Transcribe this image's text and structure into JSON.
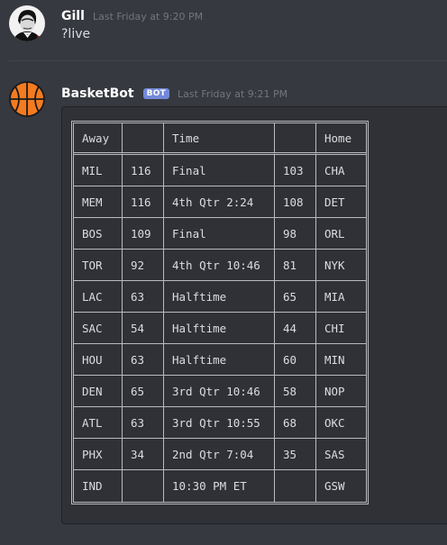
{
  "messages": [
    {
      "author": "Gill",
      "timestamp": "Last Friday at 9:20 PM",
      "text": "?live"
    },
    {
      "author": "BasketBot",
      "bot_tag": "BOT",
      "timestamp": "Last Friday at 9:21 PM"
    }
  ],
  "colors": {
    "background": "#36393f",
    "codeblock": "#2f3136",
    "bot_tag": "#7289da",
    "ball": "#f47b20"
  },
  "table": {
    "headers": [
      "Away",
      "",
      "Time",
      "",
      "Home"
    ],
    "rows": [
      [
        "MIL",
        "116",
        "Final",
        "103",
        "CHA"
      ],
      [
        "MEM",
        "116",
        "4th Qtr 2:24",
        "108",
        "DET"
      ],
      [
        "BOS",
        "109",
        "Final",
        "98",
        "ORL"
      ],
      [
        "TOR",
        "92",
        "4th Qtr 10:46",
        "81",
        "NYK"
      ],
      [
        "LAC",
        "63",
        "Halftime",
        "65",
        "MIA"
      ],
      [
        "SAC",
        "54",
        "Halftime",
        "44",
        "CHI"
      ],
      [
        "HOU",
        "63",
        "Halftime",
        "60",
        "MIN"
      ],
      [
        "DEN",
        "65",
        "3rd Qtr 10:46",
        "58",
        "NOP"
      ],
      [
        "ATL",
        "63",
        "3rd Qtr 10:55",
        "68",
        "OKC"
      ],
      [
        "PHX",
        "34",
        "2nd Qtr 7:04",
        "35",
        "SAS"
      ],
      [
        "IND",
        "",
        "10:30 PM ET",
        "",
        "GSW"
      ]
    ]
  }
}
